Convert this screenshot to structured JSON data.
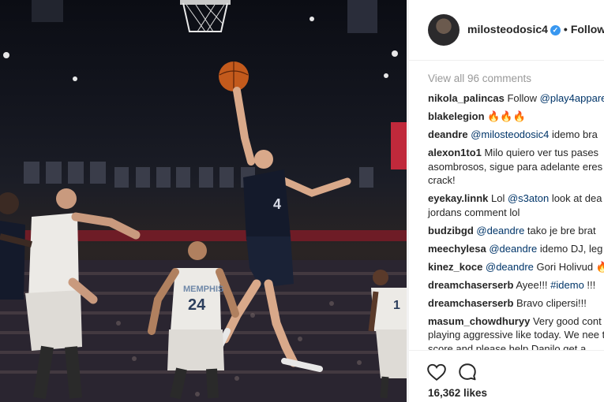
{
  "post": {
    "username": "milosteodosic4",
    "verified_glyph": "✓",
    "separator": "•",
    "follow_label": "Followin",
    "view_all_label": "View all 96 comments",
    "likes_label": "16,362 likes",
    "jerseys": {
      "player_left": "4",
      "player_mid_team": "MEMPHIS",
      "player_mid_number": "24",
      "player_right_number": "1"
    }
  },
  "comments": [
    {
      "user": "nikola_palincas",
      "parts": [
        {
          "t": "Follow "
        },
        {
          "t": "@play4appare",
          "mention": true
        }
      ]
    },
    {
      "user": "blakelegion",
      "parts": [
        {
          "t": "🔥🔥🔥"
        }
      ]
    },
    {
      "user": "deandre",
      "parts": [
        {
          "t": "@milosteodosic4",
          "mention": true
        },
        {
          "t": " idemo bra"
        }
      ]
    },
    {
      "user": "alexon1to1",
      "parts": [
        {
          "t": "Milo quiero ver tus pases asombrosos, sigue para adelante eres crack!"
        }
      ],
      "wrap": true
    },
    {
      "user": "eyekay.linnk",
      "parts": [
        {
          "t": "Lol "
        },
        {
          "t": "@s3aton",
          "mention": true
        },
        {
          "t": " look at dea jordans comment lol"
        }
      ],
      "wrap": true
    },
    {
      "user": "budzibgd",
      "parts": [
        {
          "t": "@deandre",
          "mention": true
        },
        {
          "t": " tako je bre brat"
        }
      ]
    },
    {
      "user": "meechylesa",
      "parts": [
        {
          "t": "@deandre",
          "mention": true
        },
        {
          "t": " idemo DJ, leg"
        }
      ]
    },
    {
      "user": "kinez_koce",
      "parts": [
        {
          "t": "@deandre",
          "mention": true
        },
        {
          "t": " Gori Holivud 🔥"
        }
      ]
    },
    {
      "user": "dreamchaserserb",
      "parts": [
        {
          "t": "Ayee!!! "
        },
        {
          "t": "#idemo",
          "mention": true
        },
        {
          "t": " !!!"
        }
      ]
    },
    {
      "user": "dreamchaserserb",
      "parts": [
        {
          "t": "Bravo clipersi!!!"
        }
      ]
    },
    {
      "user": "masum_chowdhuryy",
      "parts": [
        {
          "t": "Very good cont playing aggressive like today. We nee to score and please help Danilo get a"
        }
      ],
      "wrap": true
    }
  ],
  "icons": {
    "like": "heart-icon",
    "comment": "comment-bubble-icon",
    "verified": "verified-badge-icon"
  },
  "colors": {
    "mention": "#003569",
    "verified": "#3897f0",
    "text": "#262626",
    "muted": "#999999"
  }
}
